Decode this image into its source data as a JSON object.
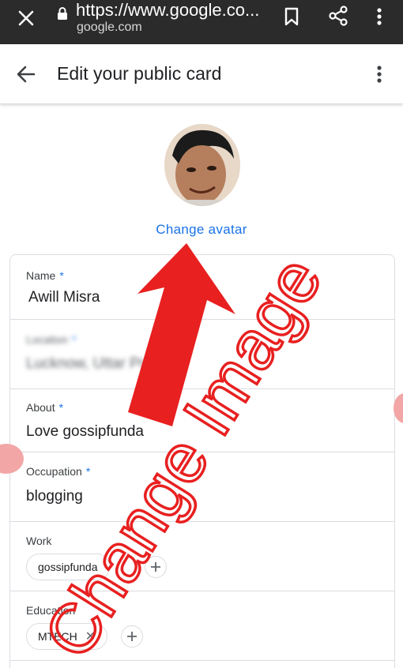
{
  "browser": {
    "url": "https://www.google.co...",
    "domain": "google.com",
    "icons": [
      "close-icon",
      "lock-icon",
      "bookmark-icon",
      "share-icon",
      "more-vert-icon"
    ]
  },
  "header": {
    "title": "Edit your public card",
    "icons": [
      "arrow-back-icon",
      "more-vert-icon"
    ]
  },
  "avatar": {
    "change_label": "Change avatar"
  },
  "form": {
    "name": {
      "label": "Name",
      "required": "*",
      "value": "Awill Misra"
    },
    "location": {
      "label": "Location",
      "required": "*",
      "value": "Lucknow, Uttar Pradesh"
    },
    "about": {
      "label": "About",
      "required": "*",
      "value": "Love gossipfunda"
    },
    "occupation": {
      "label": "Occupation",
      "required": "*",
      "value": "blogging"
    },
    "work": {
      "label": "Work",
      "chips": [
        "gossipfunda"
      ]
    },
    "education": {
      "label": "Education",
      "chips": [
        "MTECH"
      ]
    }
  },
  "annotation": {
    "text": "Change Image",
    "color": "#e82020"
  },
  "colors": {
    "accent": "#1a73e8",
    "chrome_bg": "#2b2b2b",
    "annotation": "#e82020"
  }
}
